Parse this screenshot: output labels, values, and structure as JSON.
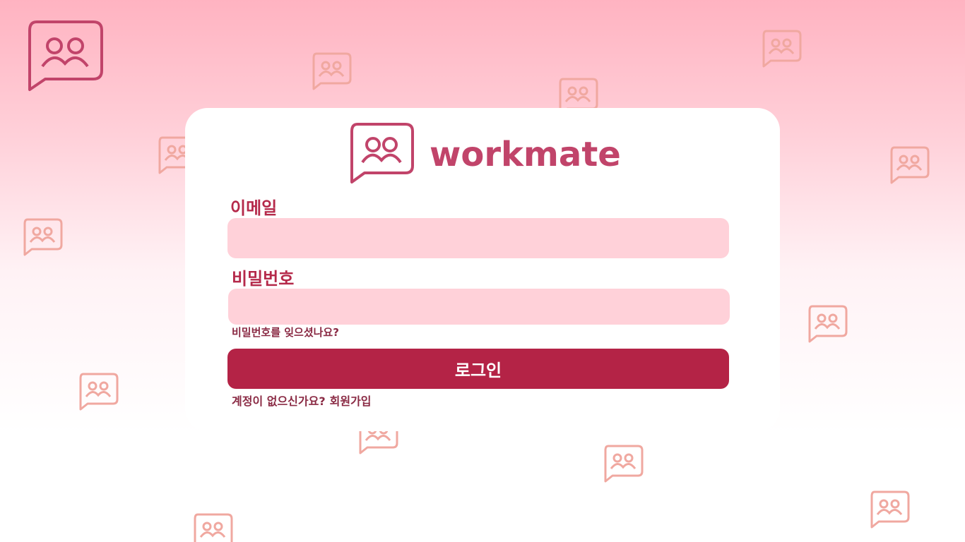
{
  "brand": {
    "name": "workmate",
    "color": "#c1446a",
    "icon": "chat-people-icon"
  },
  "login_form": {
    "email_label": "이메일",
    "email_value": "",
    "password_label": "비밀번호",
    "password_value": "",
    "forgot_password_link": "비밀번호를 잊으셨나요?",
    "login_button": "로그인",
    "no_account_text": "계정이 없으신가요?",
    "signup_link": "회원가입"
  },
  "colors": {
    "accent": "#b42346",
    "input_bg": "#ffd1d9",
    "background_top": "#ffb3c1",
    "background_bottom": "#ffffff",
    "pattern_icon": "#f0a8a0"
  }
}
